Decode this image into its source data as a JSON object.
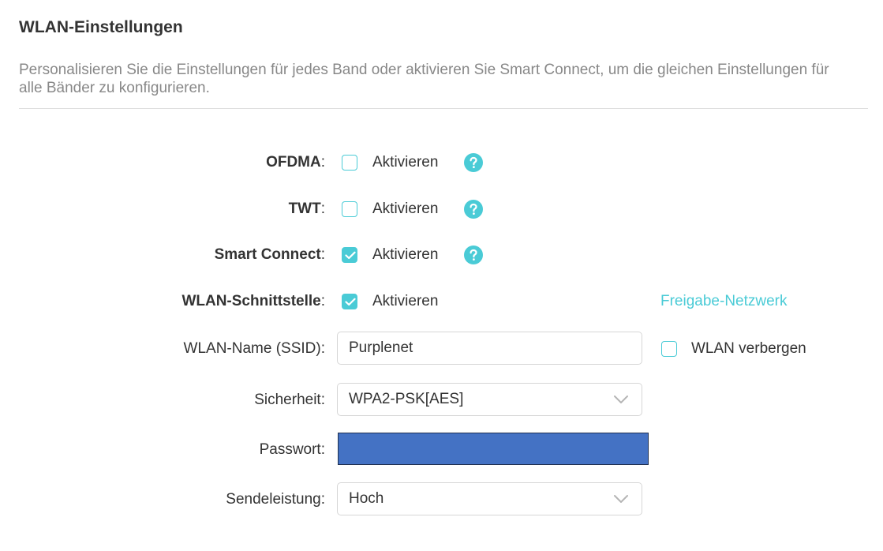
{
  "section": {
    "title": "WLAN-Einstellungen",
    "description": "Personalisieren Sie die Einstellungen für jedes Band oder aktivieren Sie Smart Connect, um die gleichen Einstellungen für alle Bänder zu konfigurieren."
  },
  "ofdma": {
    "label": "OFDMA",
    "checkbox_label": "Aktivieren",
    "checked": false,
    "help_icon": "question-circle-icon"
  },
  "twt": {
    "label": "TWT",
    "checkbox_label": "Aktivieren",
    "checked": false,
    "help_icon": "question-circle-icon"
  },
  "smart_connect": {
    "label": "Smart Connect",
    "checkbox_label": "Aktivieren",
    "checked": true,
    "help_icon": "question-circle-icon"
  },
  "wlan_interface": {
    "label": "WLAN-Schnittstelle",
    "checkbox_label": "Aktivieren",
    "checked": true,
    "link": "Freigabe-Netzwerk"
  },
  "ssid": {
    "label": "WLAN-Name (SSID):",
    "value": "Purplenet",
    "hide_label": "WLAN verbergen",
    "hide_checked": false
  },
  "security": {
    "label": "Sicherheit:",
    "value": "WPA2-PSK[AES]"
  },
  "password": {
    "label": "Passwort:"
  },
  "tx_power": {
    "label": "Sendeleistung:",
    "value": "Hoch"
  },
  "colors": {
    "accent": "#4acbd6",
    "text": "#333333",
    "muted": "#888888",
    "redaction": "#4472c4"
  }
}
